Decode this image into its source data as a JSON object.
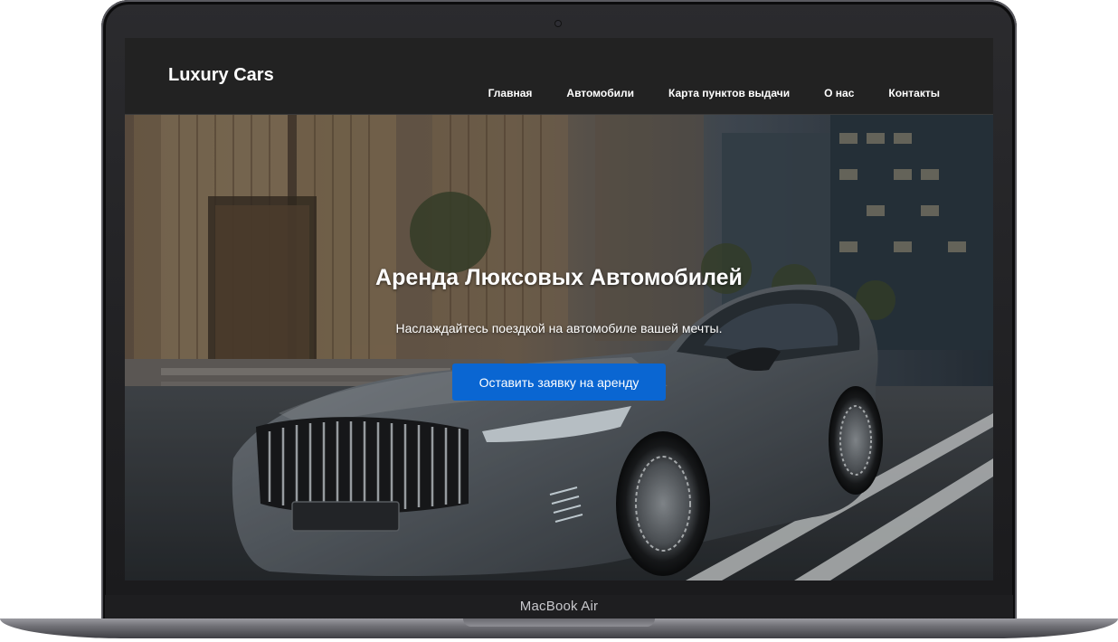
{
  "device": {
    "label": "MacBook Air"
  },
  "site": {
    "logo": "Luxury Cars",
    "nav": [
      {
        "label": "Главная"
      },
      {
        "label": "Автомобили"
      },
      {
        "label": "Карта пунктов выдачи"
      },
      {
        "label": "О нас"
      },
      {
        "label": "Контакты"
      }
    ]
  },
  "hero": {
    "title": "Аренда Люксовых Автомобилей",
    "subtitle": "Наслаждайтесь поездкой на автомобиле вашей мечты.",
    "cta_label": "Оставить заявку на аренду"
  },
  "colors": {
    "header_bg": "#222222",
    "cta_bg": "#0a66d2",
    "text": "#ffffff"
  }
}
